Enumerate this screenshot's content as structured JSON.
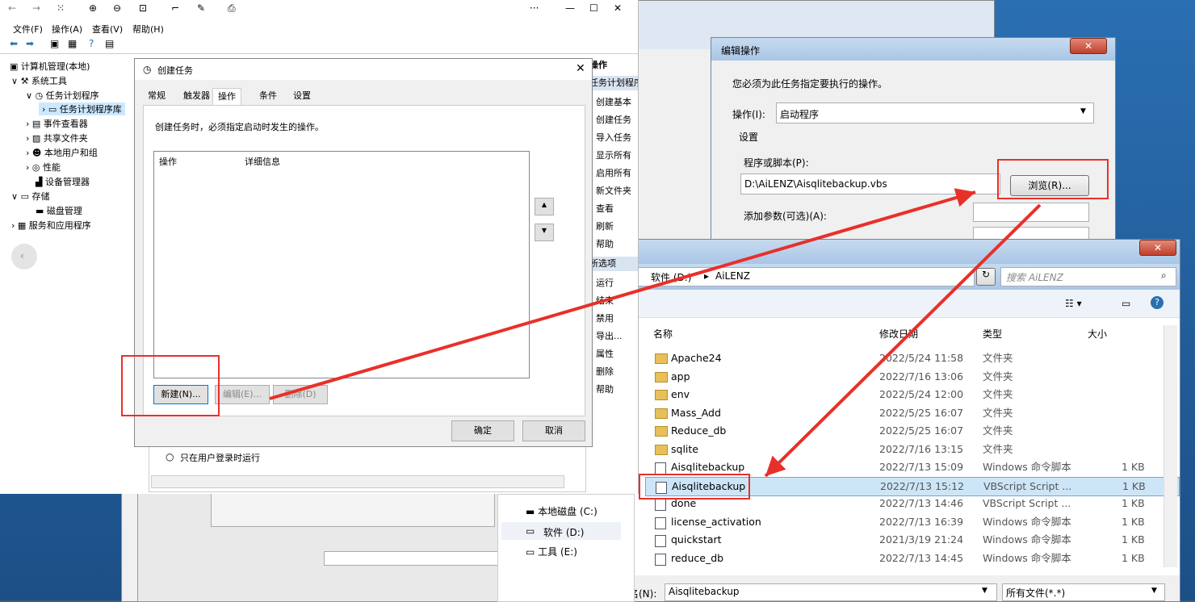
{
  "mmc": {
    "menu": [
      "文件(F)",
      "操作(A)",
      "查看(V)",
      "帮助(H)"
    ],
    "tree": {
      "root": "计算机管理(本地)",
      "system_tools": "系统工具",
      "task_scheduler": "任务计划程序",
      "task_library": "任务计划程序库",
      "event_viewer": "事件查看器",
      "shared_folders": "共享文件夹",
      "local_users": "本地用户和组",
      "performance": "性能",
      "device_manager": "设备管理器",
      "storage": "存储",
      "disk_management": "磁盘管理",
      "services_apps": "服务和应用程序"
    },
    "actions": {
      "header": "操作",
      "section1": "任务计划程序",
      "items": [
        "创建基本",
        "创建任务",
        "导入任务",
        "显示所有",
        "启用所有",
        "新文件夹",
        "查看",
        "刷新",
        "帮助"
      ],
      "section2": "所选项",
      "items2": [
        "运行",
        "结束",
        "禁用",
        "导出...",
        "属性",
        "删除",
        "帮助"
      ]
    }
  },
  "create_task": {
    "title": "创建任务",
    "tabs": [
      "常规",
      "触发器",
      "操作",
      "条件",
      "设置"
    ],
    "active_tab": "操作",
    "description": "创建任务时，必须指定启动时发生的操作。",
    "columns": [
      "操作",
      "详细信息"
    ],
    "buttons": {
      "new": "新建(N)...",
      "edit": "编辑(E)...",
      "delete": "删除(D)",
      "ok": "确定",
      "cancel": "取消"
    },
    "behind_option": "只在用户登录时运行"
  },
  "edit_action": {
    "title": "编辑操作",
    "instruction": "您必须为此任务指定要执行的操作。",
    "action_label": "操作(I):",
    "action_value": "启动程序",
    "settings_label": "设置",
    "program_label": "程序或脚本(P):",
    "program_value": "D:\\AiLENZ\\Aisqlitebackup.vbs",
    "browse": "浏览(R)...",
    "args_label": "添加参数(可选)(A):"
  },
  "file_dialog": {
    "breadcrumb": [
      "软件 (D:)",
      "AiLENZ"
    ],
    "search_placeholder": "搜索 AiLENZ",
    "columns": {
      "name": "名称",
      "date": "修改日期",
      "type": "类型",
      "size": "大小"
    },
    "rows": [
      {
        "name": "Apache24",
        "date": "2022/5/24 11:58",
        "type": "文件夹",
        "size": "",
        "kind": "folder"
      },
      {
        "name": "app",
        "date": "2022/7/16 13:06",
        "type": "文件夹",
        "size": "",
        "kind": "folder"
      },
      {
        "name": "env",
        "date": "2022/5/24 12:00",
        "type": "文件夹",
        "size": "",
        "kind": "folder"
      },
      {
        "name": "Mass_Add",
        "date": "2022/5/25 16:07",
        "type": "文件夹",
        "size": "",
        "kind": "folder"
      },
      {
        "name": "Reduce_db",
        "date": "2022/5/25 16:07",
        "type": "文件夹",
        "size": "",
        "kind": "folder"
      },
      {
        "name": "sqlite",
        "date": "2022/7/16 13:15",
        "type": "文件夹",
        "size": "",
        "kind": "folder"
      },
      {
        "name": "Aisqlitebackup",
        "date": "2022/7/13 15:09",
        "type": "Windows 命令脚本",
        "size": "1 KB",
        "kind": "script"
      },
      {
        "name": "Aisqlitebackup",
        "date": "2022/7/13 15:12",
        "type": "VBScript Script ...",
        "size": "1 KB",
        "kind": "script"
      },
      {
        "name": "done",
        "date": "2022/7/13 14:46",
        "type": "VBScript Script ...",
        "size": "1 KB",
        "kind": "script"
      },
      {
        "name": "license_activation",
        "date": "2022/7/13 16:39",
        "type": "Windows 命令脚本",
        "size": "1 KB",
        "kind": "script"
      },
      {
        "name": "quickstart",
        "date": "2021/3/19 21:24",
        "type": "Windows 命令脚本",
        "size": "1 KB",
        "kind": "script"
      },
      {
        "name": "reduce_db",
        "date": "2022/7/13 14:45",
        "type": "Windows 命令脚本",
        "size": "1 KB",
        "kind": "script"
      }
    ],
    "selected_index": 7,
    "nav": [
      "本地磁盘 (C:)",
      "软件 (D:)",
      "工具 (E:)"
    ],
    "filename_label": "文件名(N):",
    "filename_value": "Aisqlitebackup",
    "filter": "所有文件(*.*)"
  },
  "colors": {
    "highlight": "#e8302a",
    "selection": "#cde6f7"
  }
}
